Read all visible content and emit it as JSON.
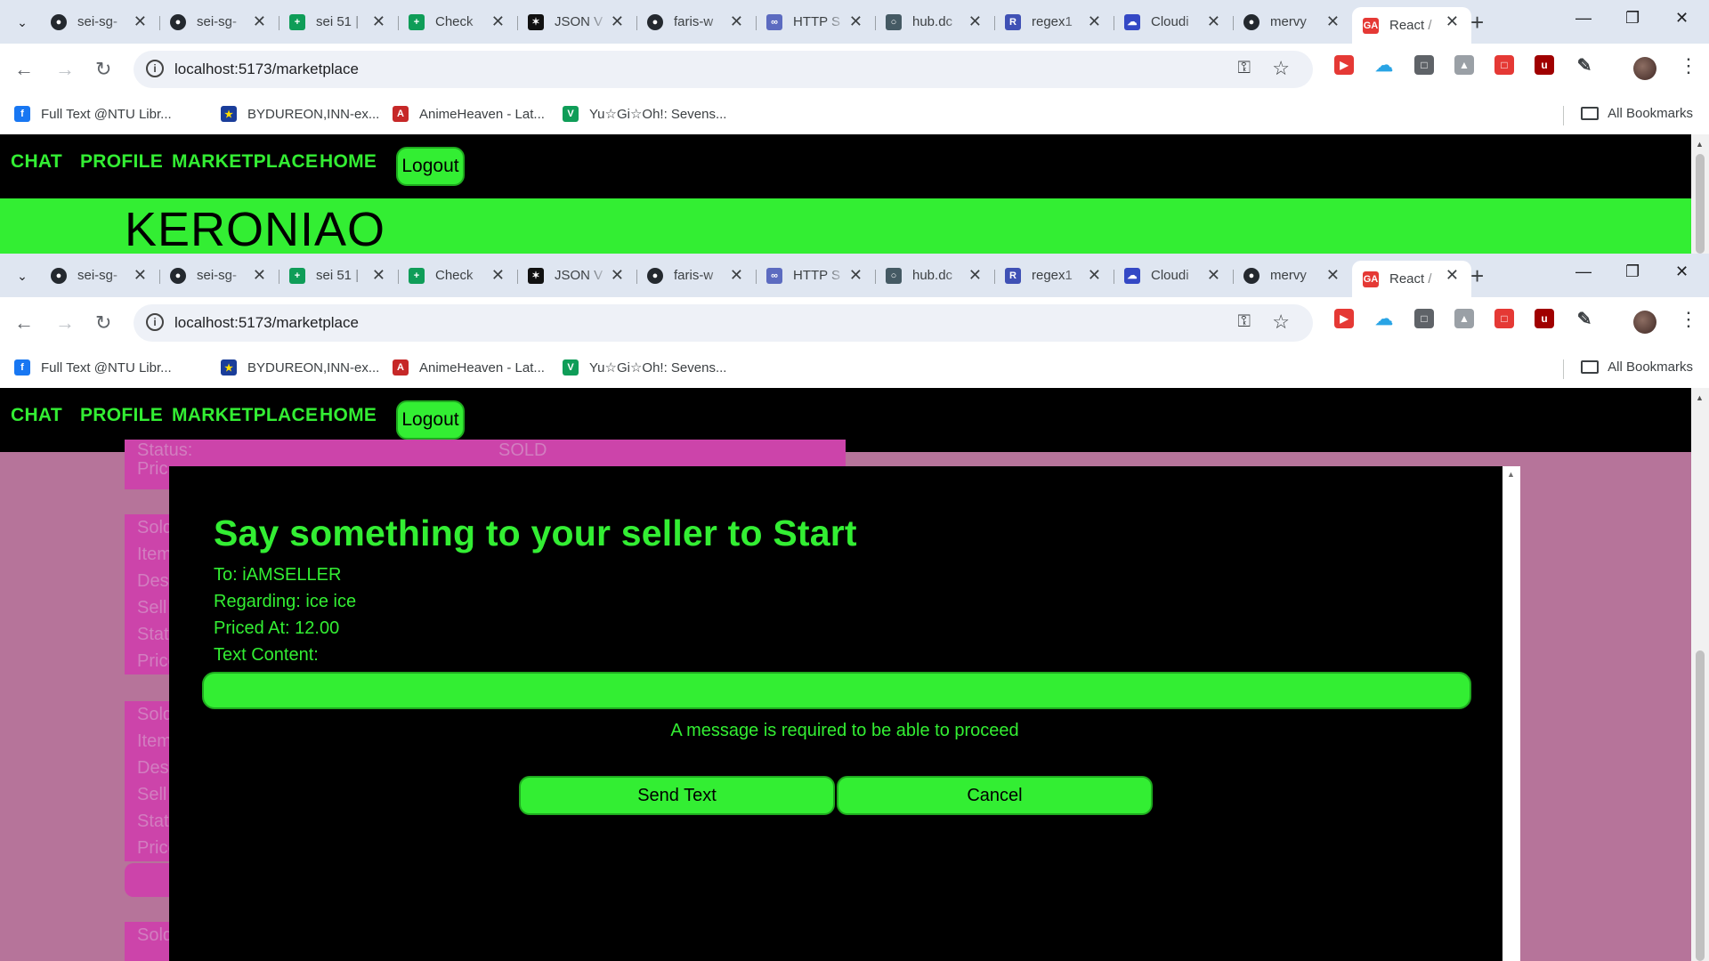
{
  "browser": {
    "tabs": [
      {
        "title": "sei-sg-",
        "favicon": "github-icon"
      },
      {
        "title": "sei-sg-",
        "favicon": "github-icon"
      },
      {
        "title": "sei 51 |",
        "favicon": "sheets-icon"
      },
      {
        "title": "Check",
        "favicon": "sheets-icon"
      },
      {
        "title": "JSON V",
        "favicon": "json-icon"
      },
      {
        "title": "faris-w",
        "favicon": "github-icon"
      },
      {
        "title": "HTTP S",
        "favicon": "http-icon"
      },
      {
        "title": "hub.dc",
        "favicon": "docker-icon"
      },
      {
        "title": "regex1",
        "favicon": "regex-icon"
      },
      {
        "title": "Cloudi",
        "favicon": "cloudinary-icon"
      },
      {
        "title": "mervy",
        "favicon": "github-icon"
      },
      {
        "title": "React /",
        "favicon": "ga-icon",
        "active": true
      }
    ],
    "url": "localhost:5173/marketplace",
    "bookmarks": [
      {
        "label": "Full Text @NTU Libr...",
        "icon": "facebook-icon"
      },
      {
        "label": "BYDUREON,INN-ex...",
        "icon": "eu-icon"
      },
      {
        "label": "AnimeHeaven - Lat...",
        "icon": "animeheaven-icon"
      },
      {
        "label": "Yu☆Gi☆Oh!: Sevens...",
        "icon": "tv-icon"
      }
    ],
    "all_bookmarks": "All Bookmarks",
    "colors": {
      "tabstrip": "#dfe6f1",
      "omnibox": "#eef1f7"
    }
  },
  "app": {
    "nav": [
      "CHAT",
      "PROFILE",
      "MARKETPLACE",
      "HOME"
    ],
    "logout": "Logout",
    "brand": "KERONIAO",
    "colors": {
      "accent": "#33ee33",
      "nav_bg": "#000000",
      "page_bg": "#b6749a",
      "card_bg": "#cc44aa"
    },
    "background_cards": {
      "partial_top_rows": [
        {
          "label": "Status:",
          "value": "SOLD"
        },
        {
          "label": "Pric",
          "value": ""
        }
      ],
      "card_row_labels": [
        "Sold",
        "Item",
        "Desc",
        "Sell",
        "Stat",
        "Price"
      ],
      "last_row_label": "Sold"
    }
  },
  "modal": {
    "title": "Say something to your seller to Start",
    "to": "To: iAMSELLER",
    "regarding": "Regarding: ice ice",
    "priced_at": "Priced At: 12.00",
    "text_content_label": "Text Content:",
    "input_value": "",
    "warning": "A message is required to be able to proceed",
    "send_button": "Send Text",
    "cancel_button": "Cancel"
  }
}
